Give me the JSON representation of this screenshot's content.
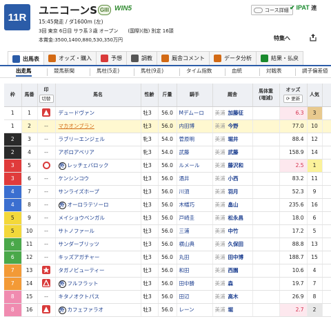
{
  "race": {
    "number": "11R",
    "name": "ユニコーンS",
    "grade": "GIII",
    "win5": "WIN5",
    "info1": "15:45発走 / ダ1600m (左)",
    "info2": "3回 東京 6日目 サラ系３歳 オープン　　(国際)(指) 別定 16頭",
    "info3": "本賞金:3500,1400,880,530,350万円",
    "course_detail": "コース詳細",
    "ipat": "IPAT",
    "ipat_tail": "連",
    "feature": "特集へ"
  },
  "tabs": [
    {
      "label": "出馬表",
      "icon": "horse-icon",
      "active": true
    },
    {
      "label": "オッズ・購入",
      "icon": "ticket-icon",
      "active": false
    },
    {
      "label": "予想",
      "icon": "prediction-icon",
      "active": false
    },
    {
      "label": "調教",
      "icon": "training-icon",
      "active": false
    },
    {
      "label": "厩舎コメント",
      "icon": "comment-icon",
      "active": false
    },
    {
      "label": "データ分析",
      "icon": "chart-icon",
      "active": false
    },
    {
      "label": "結果・払戻",
      "icon": "result-icon",
      "active": false
    }
  ],
  "subtabs": [
    "出走馬",
    "競馬新聞",
    "馬柱(5走)",
    "馬柱(9走)",
    "タイム指数",
    "血統",
    "対戦表",
    "調子偏差値"
  ],
  "headers": {
    "waku": "枠",
    "umaban": "馬番",
    "mark": "印",
    "mark_switch": "切替",
    "horse": "馬名",
    "sexage": "性齢",
    "weight": "斤量",
    "jockey": "騎手",
    "trainer": "厩舎",
    "body_weight": "馬体重",
    "body_weight_sub": "(増減)",
    "odds": "オッズ",
    "odds_update": "更新",
    "popularity": "人気"
  },
  "waku_colors": {
    "1": {
      "bg": "#ffffff",
      "fg": "#222222"
    },
    "2": {
      "bg": "#2a2a2a",
      "fg": "#ffffff"
    },
    "3": {
      "bg": "#e03b3b",
      "fg": "#ffffff"
    },
    "4": {
      "bg": "#3b6fd0",
      "fg": "#ffffff"
    },
    "5": {
      "bg": "#f3d83a",
      "fg": "#222222"
    },
    "6": {
      "bg": "#4aa84a",
      "fg": "#ffffff"
    },
    "7": {
      "bg": "#f39a36",
      "fg": "#ffffff"
    },
    "8": {
      "bg": "#f08bb0",
      "fg": "#ffffff"
    }
  },
  "horses": [
    {
      "waku": "1",
      "num": "1",
      "mark": "tri",
      "prefix": "",
      "name": "デュードヴァン",
      "sexage": "牡3",
      "weight": "56.0",
      "jockey": "Mデムーロ",
      "region": "美浦",
      "trainer": "加藤征",
      "odds": "6.3",
      "pop": "3",
      "odds_pink": true,
      "pop_class": "pop-3"
    },
    {
      "waku": "1",
      "num": "2",
      "mark": "dash",
      "prefix": "",
      "name": "マカオンブラン",
      "sexage": "牡3",
      "weight": "56.0",
      "jockey": "内田博",
      "region": "美浦",
      "trainer": "今野",
      "odds": "77.0",
      "pop": "10",
      "odds_pink": false,
      "pop_class": "",
      "highlight": true
    },
    {
      "waku": "2",
      "num": "3",
      "mark": "dash",
      "prefix": "",
      "name": "ラブリーエンジェル",
      "sexage": "牝3",
      "weight": "54.0",
      "jockey": "菅原明",
      "region": "美浦",
      "trainer": "堀井",
      "odds": "88.4",
      "pop": "12",
      "odds_pink": false,
      "pop_class": ""
    },
    {
      "waku": "2",
      "num": "4",
      "mark": "dash",
      "prefix": "",
      "name": "アポロアベリア",
      "sexage": "牝3",
      "weight": "54.0",
      "jockey": "武藤",
      "region": "美浦",
      "trainer": "武藤",
      "odds": "158.9",
      "pop": "14",
      "odds_pink": false,
      "pop_class": ""
    },
    {
      "waku": "3",
      "num": "5",
      "mark": "ring",
      "prefix": "外",
      "name": "レッチェバロック",
      "sexage": "牡3",
      "weight": "56.0",
      "jockey": "ルメール",
      "region": "美浦",
      "trainer": "藤沢和",
      "odds": "2.5",
      "pop": "1",
      "odds_pink": true,
      "pop_class": "pop-1"
    },
    {
      "waku": "3",
      "num": "6",
      "mark": "dash",
      "prefix": "",
      "name": "ケンシンコウ",
      "sexage": "牡3",
      "weight": "56.0",
      "jockey": "酒井",
      "region": "美浦",
      "trainer": "小西",
      "odds": "83.2",
      "pop": "11",
      "odds_pink": false,
      "pop_class": ""
    },
    {
      "waku": "4",
      "num": "7",
      "mark": "dash",
      "prefix": "",
      "name": "サンライズホープ",
      "sexage": "牡3",
      "weight": "56.0",
      "jockey": "川須",
      "region": "美浦",
      "trainer": "羽月",
      "odds": "52.3",
      "pop": "9",
      "odds_pink": false,
      "pop_class": ""
    },
    {
      "waku": "4",
      "num": "8",
      "mark": "dash",
      "prefix": "外",
      "name": "オーロラテソーロ",
      "sexage": "牡3",
      "weight": "56.0",
      "jockey": "木幡巧",
      "region": "美浦",
      "trainer": "畠山",
      "odds": "235.6",
      "pop": "16",
      "odds_pink": false,
      "pop_class": ""
    },
    {
      "waku": "5",
      "num": "9",
      "mark": "dash",
      "prefix": "",
      "name": "メイショウベンガル",
      "sexage": "牡3",
      "weight": "56.0",
      "jockey": "戸崎圭",
      "region": "美浦",
      "trainer": "松永昌",
      "odds": "18.0",
      "pop": "6",
      "odds_pink": false,
      "pop_class": ""
    },
    {
      "waku": "5",
      "num": "10",
      "mark": "dash",
      "prefix": "",
      "name": "サトノファール",
      "sexage": "牡3",
      "weight": "56.0",
      "jockey": "三浦",
      "region": "美浦",
      "trainer": "中竹",
      "odds": "17.2",
      "pop": "5",
      "odds_pink": false,
      "pop_class": ""
    },
    {
      "waku": "6",
      "num": "11",
      "mark": "dash",
      "prefix": "",
      "name": "サンダーブリッツ",
      "sexage": "牡3",
      "weight": "56.0",
      "jockey": "横山典",
      "region": "美浦",
      "trainer": "久保田",
      "odds": "88.8",
      "pop": "13",
      "odds_pink": false,
      "pop_class": ""
    },
    {
      "waku": "6",
      "num": "12",
      "mark": "dash",
      "prefix": "",
      "name": "キッズアガチャー",
      "sexage": "牡3",
      "weight": "56.0",
      "jockey": "丸田",
      "region": "美浦",
      "trainer": "田中博",
      "odds": "188.7",
      "pop": "15",
      "odds_pink": false,
      "pop_class": ""
    },
    {
      "waku": "7",
      "num": "13",
      "mark": "star",
      "prefix": "",
      "name": "タガノビューティー",
      "sexage": "牡3",
      "weight": "56.0",
      "jockey": "和田",
      "region": "美浦",
      "trainer": "西園",
      "odds": "10.6",
      "pop": "4",
      "odds_pink": false,
      "pop_class": ""
    },
    {
      "waku": "7",
      "num": "14",
      "mark": "blanktri",
      "prefix": "外",
      "name": "フルフラット",
      "sexage": "牡3",
      "weight": "56.0",
      "jockey": "田中勝",
      "region": "美浦",
      "trainer": "森",
      "odds": "19.7",
      "pop": "7",
      "odds_pink": false,
      "pop_class": ""
    },
    {
      "waku": "8",
      "num": "15",
      "mark": "dash",
      "prefix": "",
      "name": "キタノオクトパス",
      "sexage": "牡3",
      "weight": "56.0",
      "jockey": "田辺",
      "region": "美浦",
      "trainer": "高木",
      "odds": "26.9",
      "pop": "8",
      "odds_pink": false,
      "pop_class": ""
    },
    {
      "waku": "8",
      "num": "16",
      "mark": "tri",
      "prefix": "外",
      "name": "カフェファラオ",
      "sexage": "牡3",
      "weight": "56.0",
      "jockey": "レーン",
      "region": "美浦",
      "trainer": "堀",
      "odds": "2.7",
      "pop": "2",
      "odds_pink": true,
      "pop_class": "pop-2"
    }
  ]
}
